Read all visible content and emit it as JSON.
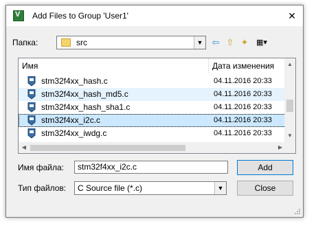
{
  "window": {
    "title": "Add Files to Group 'User1'",
    "close": "✕"
  },
  "folder": {
    "label": "Папка:",
    "value": "src"
  },
  "toolbar": {
    "back": "⇦",
    "up": "⇧",
    "new_folder": "✦",
    "view": "▦▾"
  },
  "list": {
    "columns": [
      "Имя",
      "Дата изменения"
    ],
    "rows": [
      {
        "name": "stm32f4xx_hash.c",
        "date": "04.11.2016 20:33"
      },
      {
        "name": "stm32f4xx_hash_md5.c",
        "date": "04.11.2016 20:33"
      },
      {
        "name": "stm32f4xx_hash_sha1.c",
        "date": "04.11.2016 20:33"
      },
      {
        "name": "stm32f4xx_i2c.c",
        "date": "04.11.2016 20:33"
      },
      {
        "name": "stm32f4xx_iwdg.c",
        "date": "04.11.2016 20:33"
      }
    ]
  },
  "filename": {
    "label": "Имя файла:",
    "value": "stm32f4xx_i2c.c"
  },
  "filetype": {
    "label": "Тип файлов:",
    "value": "C Source file (*.c)"
  },
  "buttons": {
    "add": "Add",
    "close": "Close"
  }
}
